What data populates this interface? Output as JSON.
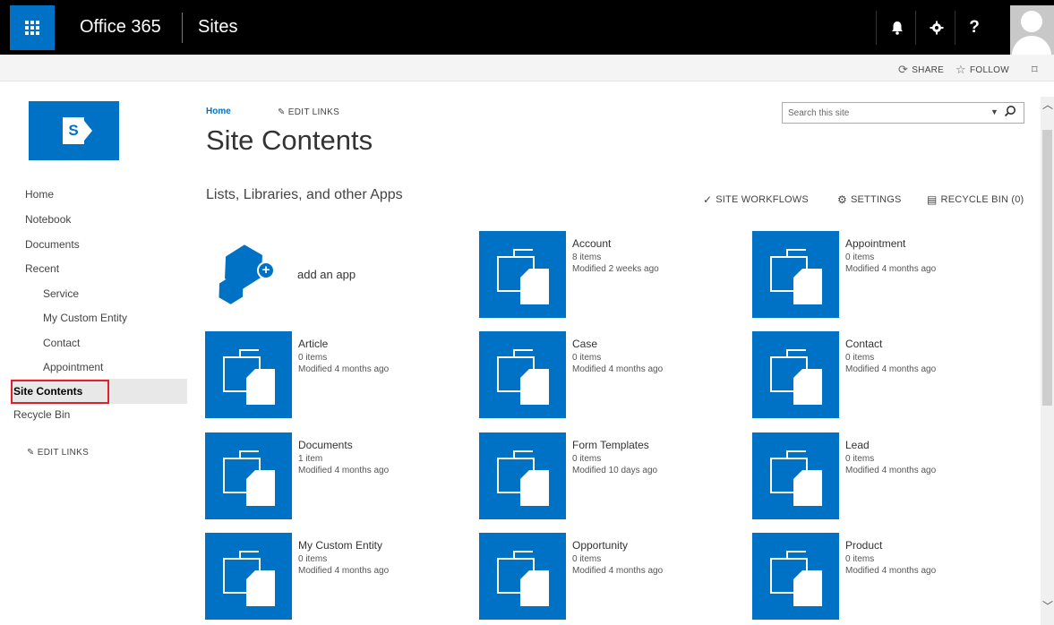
{
  "suite_bar": {
    "app_title": "Office 365",
    "site_label": "Sites",
    "icons": [
      "app-launcher-icon",
      "bell-icon",
      "gear-icon",
      "help-icon",
      "user-avatar"
    ],
    "bell_glyph": "🔔",
    "gear_glyph": "⚙",
    "help_glyph": "?"
  },
  "ribbon": {
    "share_label": "SHARE",
    "follow_label": "FOLLOW",
    "share_glyph": "⟳",
    "follow_glyph": "☆",
    "focus_glyph": "⌑"
  },
  "left_nav": {
    "items": [
      {
        "label": "Home",
        "level": "top"
      },
      {
        "label": "Notebook",
        "level": "top"
      },
      {
        "label": "Documents",
        "level": "top"
      },
      {
        "label": "Recent",
        "level": "top"
      },
      {
        "label": "Service",
        "level": "sub"
      },
      {
        "label": "My Custom Entity",
        "level": "sub"
      },
      {
        "label": "Contact",
        "level": "sub"
      },
      {
        "label": "Appointment",
        "level": "sub"
      },
      {
        "label": "Site Contents",
        "level": "top",
        "selected": true
      },
      {
        "label": "Recycle Bin",
        "level": "top"
      }
    ],
    "edit_links_label": "EDIT LINKS",
    "edit_glyph": "✎"
  },
  "header": {
    "breadcrumb_home": "Home",
    "edit_links_label": "EDIT LINKS",
    "page_title": "Site Contents",
    "search_placeholder": "Search this site",
    "search_drop_glyph": "▼",
    "search_glyph": "⚲"
  },
  "section": {
    "title": "Lists, Libraries, and other Apps",
    "site_workflows_label": "SITE WORKFLOWS",
    "settings_label": "SETTINGS",
    "recycle_bin_label": "RECYCLE BIN (0)",
    "workflows_glyph": "✓",
    "settings_glyph": "⚙",
    "recycle_glyph": "▤"
  },
  "add_app": {
    "label": "add an app"
  },
  "tiles": [
    {
      "name": "Account",
      "count": "8 items",
      "modified": "Modified 2 weeks ago"
    },
    {
      "name": "Appointment",
      "count": "0 items",
      "modified": "Modified 4 months ago"
    },
    {
      "name": "Article",
      "count": "0 items",
      "modified": "Modified 4 months ago"
    },
    {
      "name": "Case",
      "count": "0 items",
      "modified": "Modified 4 months ago"
    },
    {
      "name": "Contact",
      "count": "0 items",
      "modified": "Modified 4 months ago"
    },
    {
      "name": "Documents",
      "count": "1 item",
      "modified": "Modified 4 months ago"
    },
    {
      "name": "Form Templates",
      "count": "0 items",
      "modified": "Modified 10 days ago"
    },
    {
      "name": "Lead",
      "count": "0 items",
      "modified": "Modified 4 months ago"
    },
    {
      "name": "My Custom Entity",
      "count": "0 items",
      "modified": "Modified 4 months ago"
    },
    {
      "name": "Opportunity",
      "count": "0 items",
      "modified": "Modified 4 months ago"
    },
    {
      "name": "Product",
      "count": "0 items",
      "modified": "Modified 4 months ago"
    }
  ],
  "colors": {
    "brand_blue": "#0072c6",
    "suite_bar": "#000000",
    "selection_outline": "#e0202a"
  }
}
